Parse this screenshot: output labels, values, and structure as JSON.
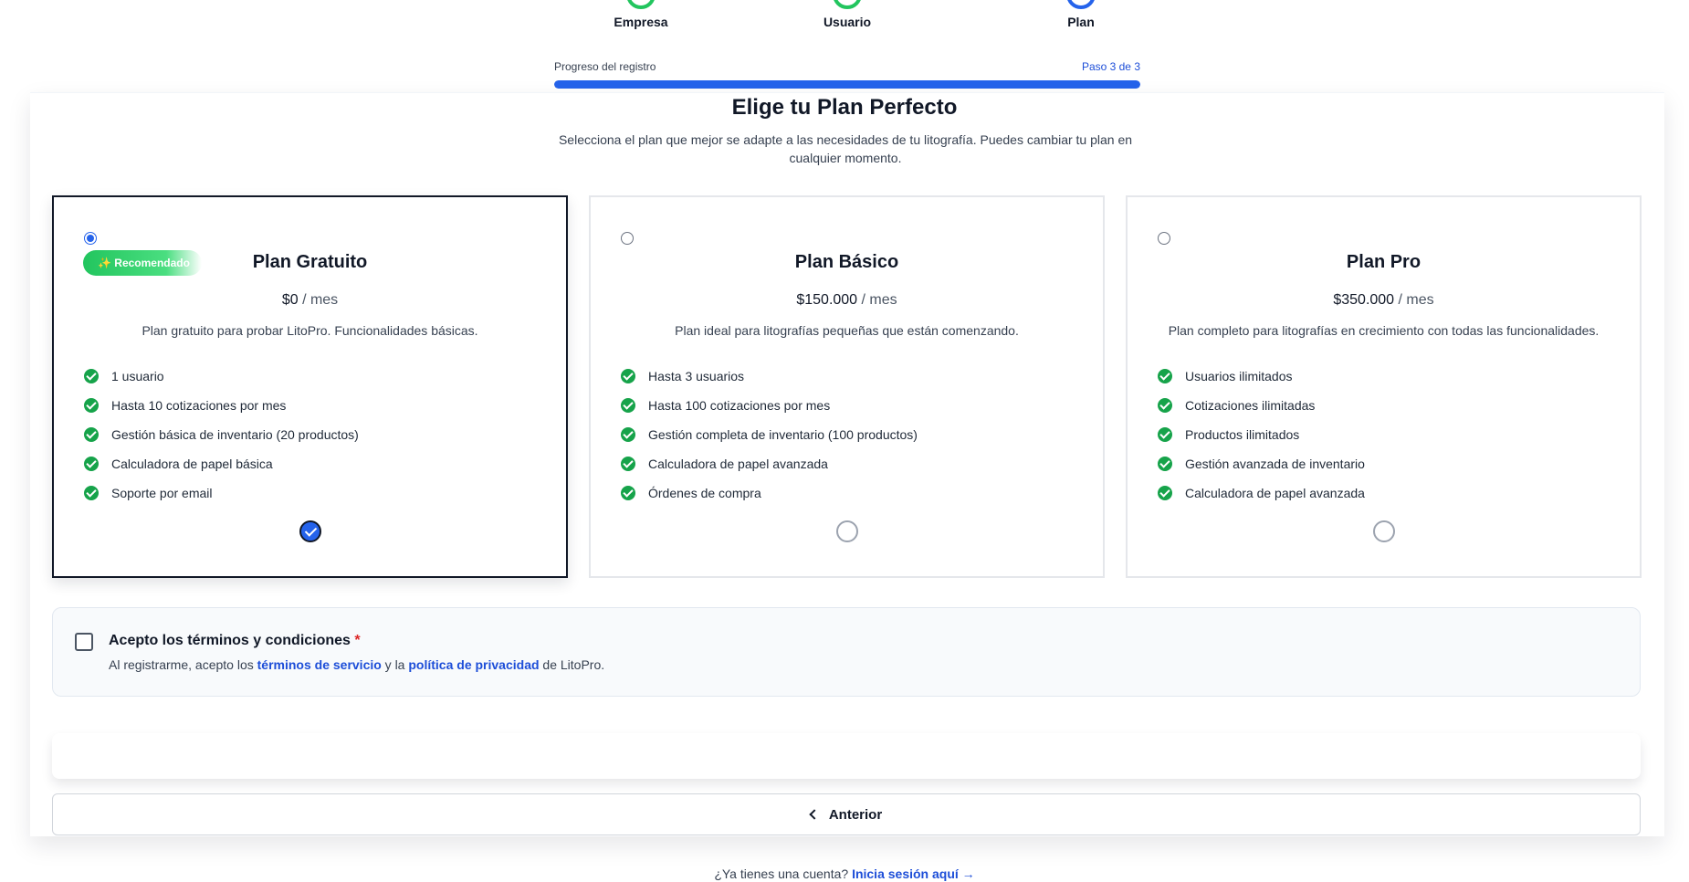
{
  "stepper": {
    "steps": [
      {
        "label": "Empresa",
        "state": "complete",
        "color": "#22c55e"
      },
      {
        "label": "Usuario",
        "state": "complete",
        "color": "#22c55e"
      },
      {
        "label": "Plan",
        "state": "current",
        "color": "#2563eb"
      }
    ]
  },
  "progress": {
    "title": "Progreso del registro",
    "step_text": "Paso 3 de 3",
    "fraction": 1.0
  },
  "header": {
    "title": "Elige tu Plan Perfecto",
    "subtitle": "Selecciona el plan que mejor se adapte a las necesidades de tu litografía. Puedes cambiar tu plan en cualquier momento."
  },
  "plans": [
    {
      "name": "Plan Gratuito",
      "badge": "✨ Recomendado",
      "price": "$0",
      "period": "/ mes",
      "description": "Plan gratuito para probar LitoPro. Funcionalidades básicas.",
      "features": [
        "1 usuario",
        "Hasta 10 cotizaciones por mes",
        "Gestión básica de inventario (20 productos)",
        "Calculadora de papel básica",
        "Soporte por email"
      ],
      "selected": true
    },
    {
      "name": "Plan Básico",
      "price": "$150.000",
      "period": "/ mes",
      "description": "Plan ideal para litografías pequeñas que están comenzando.",
      "features": [
        "Hasta 3 usuarios",
        "Hasta 100 cotizaciones por mes",
        "Gestión completa de inventario (100 productos)",
        "Calculadora de papel avanzada",
        "Órdenes de compra"
      ],
      "selected": false
    },
    {
      "name": "Plan Pro",
      "price": "$350.000",
      "period": "/ mes",
      "description": "Plan completo para litografías en crecimiento con todas las funcionalidades.",
      "features": [
        "Usuarios ilimitados",
        "Cotizaciones ilimitadas",
        "Productos ilimitados",
        "Gestión avanzada de inventario",
        "Calculadora de papel avanzada"
      ],
      "selected": false
    }
  ],
  "terms": {
    "title": "Acepto los términos y condiciones",
    "required_mark": "*",
    "text_before": "Al registrarme, acepto los ",
    "link_terms": "términos de servicio",
    "text_middle": " y la ",
    "link_privacy": "política de privacidad",
    "text_after": " de LitoPro.",
    "checked": false
  },
  "nav": {
    "prev_label": "Anterior"
  },
  "footer": {
    "text": "¿Ya tienes una cuenta? ",
    "link": "Inicia sesión aquí →"
  },
  "colors": {
    "accent": "#2563eb",
    "success": "#16a34a",
    "link": "#1d4ed8",
    "required": "#dc2626"
  }
}
